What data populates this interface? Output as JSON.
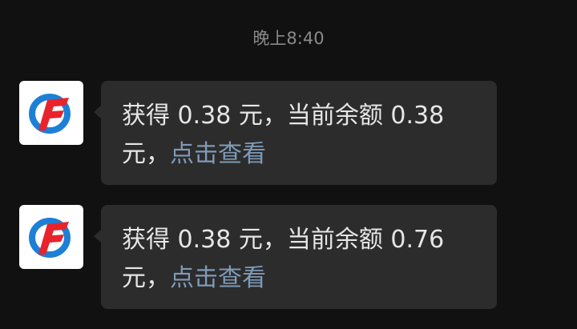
{
  "chat": {
    "timestamp": "晚上8:40",
    "messages": [
      {
        "sender_avatar_icon": "brand-logo-icon",
        "text": "获得 0.38 元，当前余额 0.38 元，",
        "link_label": "点击查看"
      },
      {
        "sender_avatar_icon": "brand-logo-icon",
        "text": "获得 0.38 元，当前余额 0.76 元，",
        "link_label": "点击查看"
      }
    ]
  },
  "colors": {
    "background": "#111111",
    "bubble": "#2c2c2c",
    "text": "#e6e6e6",
    "link": "#7f9ab8",
    "logo_red": "#e8232b",
    "logo_blue": "#1e7fd6"
  }
}
